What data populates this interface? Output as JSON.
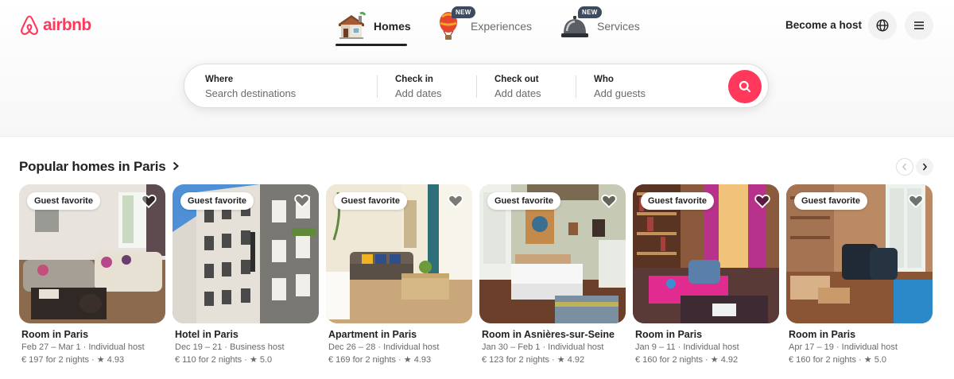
{
  "brand": {
    "name": "airbnb",
    "color": "#ff385c"
  },
  "nav": {
    "tabs": [
      {
        "label": "Homes",
        "icon": "house-icon",
        "active": true
      },
      {
        "label": "Experiences",
        "icon": "hot-air-balloon-icon",
        "badge": "NEW"
      },
      {
        "label": "Services",
        "icon": "service-bell-icon",
        "badge": "NEW"
      }
    ]
  },
  "header": {
    "become_host": "Become a host",
    "globe_icon": "globe-icon",
    "menu_icon": "hamburger-menu-icon"
  },
  "search": {
    "where": {
      "title": "Where",
      "placeholder": "Search destinations"
    },
    "check_in": {
      "title": "Check in",
      "placeholder": "Add dates"
    },
    "check_out": {
      "title": "Check out",
      "placeholder": "Add dates"
    },
    "who": {
      "title": "Who",
      "placeholder": "Add guests"
    },
    "button_icon": "search-icon"
  },
  "section": {
    "title": "Popular homes in Paris",
    "title_icon": "chevron-right-icon",
    "prev_icon": "chevron-left-icon",
    "next_icon": "chevron-right-icon"
  },
  "listings": [
    {
      "badge": "Guest favorite",
      "title": "Room in Paris",
      "subtitle": "Feb 27 – Mar 1 · Individual host",
      "price": "€ 197 for 2 nights · ★ 4.93"
    },
    {
      "badge": "Guest favorite",
      "title": "Hotel in Paris",
      "subtitle": "Dec 19 – 21 · Business host",
      "price": "€ 110 for 2 nights · ★ 5.0"
    },
    {
      "badge": "Guest favorite",
      "title": "Apartment in Paris",
      "subtitle": "Dec 26 – 28 · Individual host",
      "price": "€ 169 for 2 nights · ★ 4.93"
    },
    {
      "badge": "Guest favorite",
      "title": "Room in Asnières-sur-Seine",
      "subtitle": "Jan 30 – Feb 1 · Individual host",
      "price": "€ 123 for 2 nights · ★ 4.92"
    },
    {
      "badge": "Guest favorite",
      "title": "Room in Paris",
      "subtitle": "Jan 9 – 11 · Individual host",
      "price": "€ 160 for 2 nights · ★ 4.92"
    },
    {
      "badge": "Guest favorite",
      "title": "Room in Paris",
      "subtitle": "Apr 17 – 19 · Individual host",
      "price": "€ 160 for 2 nights · ★ 5.0"
    }
  ]
}
